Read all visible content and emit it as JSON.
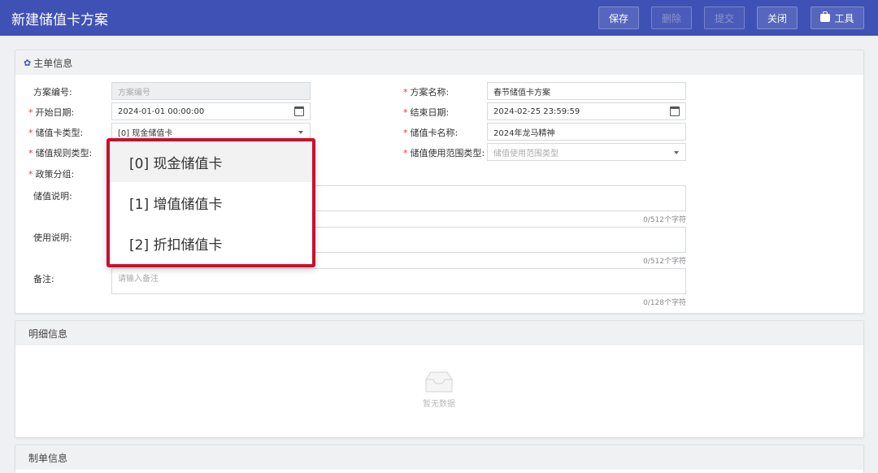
{
  "header": {
    "title": "新建储值卡方案",
    "buttons": {
      "save": "保存",
      "delete": "删除",
      "submit": "提交",
      "close": "关闭",
      "tools": "工具"
    }
  },
  "main_panel": {
    "title": "主单信息",
    "fields": {
      "scheme_no": {
        "label": "方案编号:",
        "placeholder": "方案编号"
      },
      "scheme_name": {
        "label": "方案名称:",
        "value": "春节储值卡方案"
      },
      "start_date": {
        "label": "开始日期:",
        "value": "2024-01-01 00:00:00"
      },
      "end_date": {
        "label": "结束日期:",
        "value": "2024-02-25 23:59:59"
      },
      "card_type": {
        "label": "储值卡类型:",
        "value": "[0] 现金储值卡"
      },
      "card_name": {
        "label": "储值卡名称:",
        "value": "2024年龙马精神"
      },
      "rule_type": {
        "label": "储值规则类型:"
      },
      "scope_type": {
        "label": "储值使用范围类型:",
        "placeholder": "储值使用范围类型"
      },
      "policy_group": {
        "label": "政策分组:"
      },
      "stored_desc": {
        "label": "储值说明:",
        "counter": "0/512个字符"
      },
      "usage_desc": {
        "label": "使用说明:",
        "counter": "0/512个字符"
      },
      "remark": {
        "label": "备注:",
        "placeholder": "请输入备注",
        "counter": "0/128个字符"
      }
    }
  },
  "dropdown": {
    "options": [
      "[0] 现金储值卡",
      "[1] 增值储值卡",
      "[2] 折扣储值卡"
    ],
    "highlight_color": "#c8102e"
  },
  "detail_panel": {
    "title": "明细信息",
    "empty_text": "暂无数据"
  },
  "maker_panel": {
    "title": "制单信息"
  },
  "colors": {
    "header_bg": "#3f51b5",
    "required": "#e53935"
  }
}
